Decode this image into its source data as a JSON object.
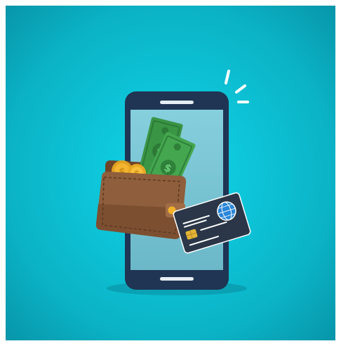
{
  "scene": {
    "icons": [
      "phone-icon",
      "wallet-icon",
      "banknote-icon",
      "coin-icon",
      "credit-card-icon",
      "sparkle-icon"
    ],
    "colors": {
      "background_center": "#0FD3E6",
      "background_edge": "#0896AA",
      "phone_body": "#1F3553",
      "phone_screen": "#7CC7D6",
      "wallet": "#8F5E3C",
      "banknote": "#3FA04A",
      "coin": "#F2B12A",
      "card": "#2B3748",
      "card_globe": "#2A86D8"
    }
  }
}
